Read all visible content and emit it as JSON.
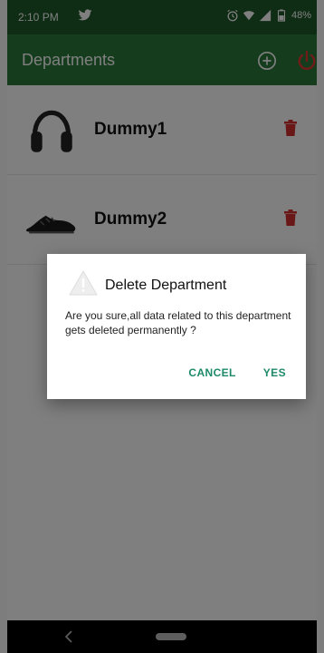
{
  "status_bar": {
    "time": "2:10 PM",
    "battery": "48%"
  },
  "app_bar": {
    "title": "Departments"
  },
  "departments": [
    {
      "name": "Dummy1",
      "image": "headphones"
    },
    {
      "name": "Dummy2",
      "image": "shoe"
    }
  ],
  "dialog": {
    "title": "Delete Department",
    "message": "Are you sure,all data related to this department gets deleted permanently ?",
    "cancel_label": "CANCEL",
    "yes_label": "YES"
  },
  "colors": {
    "status_bar": "#1f5a2b",
    "app_bar": "#2a7a3a",
    "trash": "#d32f2f",
    "dialog_button": "#1f8a6a"
  }
}
